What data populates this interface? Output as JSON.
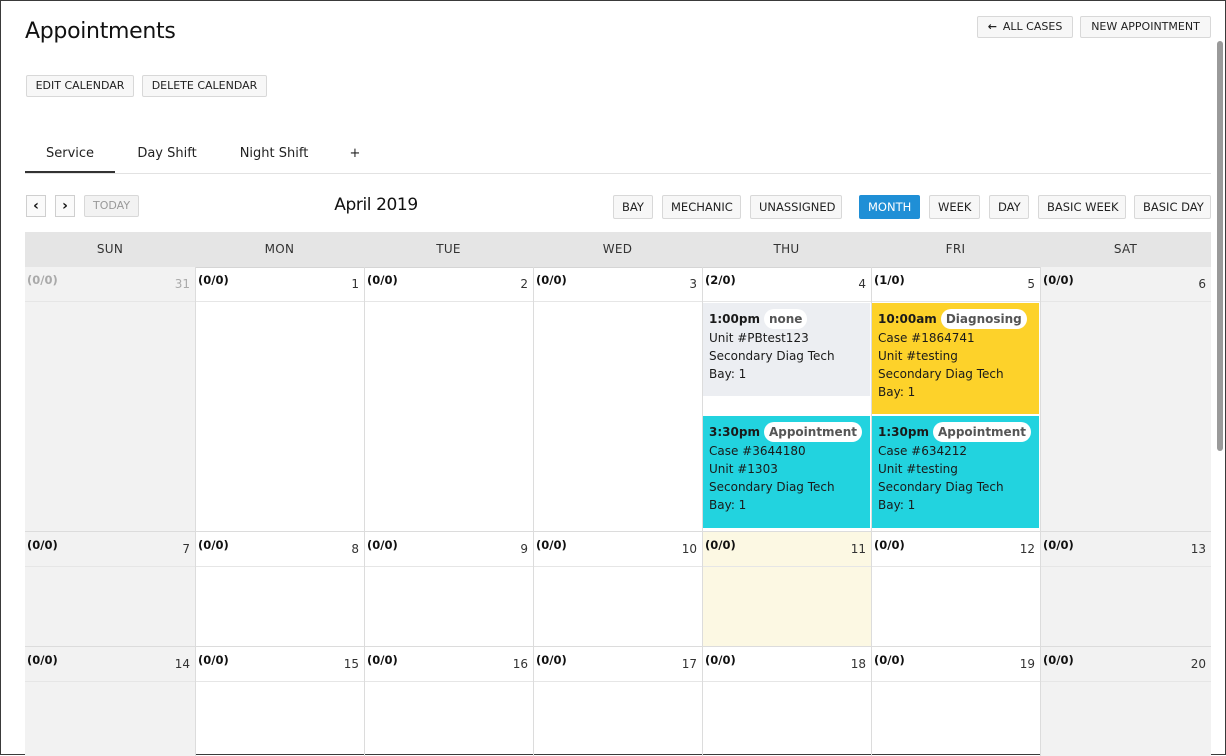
{
  "header": {
    "title": "Appointments",
    "all_cases": "ALL CASES",
    "new_appointment": "NEW APPOINTMENT",
    "edit_calendar": "EDIT CALENDAR",
    "delete_calendar": "DELETE CALENDAR"
  },
  "tabs": [
    {
      "label": "Service",
      "active": true
    },
    {
      "label": "Day Shift",
      "active": false
    },
    {
      "label": "Night Shift",
      "active": false
    },
    {
      "label": "+",
      "active": false
    }
  ],
  "toolbar": {
    "prev_icon": "chevron-left-icon",
    "next_icon": "chevron-right-icon",
    "today": "TODAY",
    "month_title": "April 2019",
    "group_buttons": [
      "BAY",
      "MECHANIC",
      "UNASSIGNED"
    ],
    "view_buttons": [
      "MONTH",
      "WEEK",
      "DAY",
      "BASIC WEEK",
      "BASIC DAY"
    ],
    "active_view": "MONTH"
  },
  "calendar": {
    "weekdays": [
      "SUN",
      "MON",
      "TUE",
      "WED",
      "THU",
      "FRI",
      "SAT"
    ],
    "weeks": [
      [
        {
          "day": "31",
          "count": "(0/0)",
          "other_month": true
        },
        {
          "day": "1",
          "count": "(0/0)"
        },
        {
          "day": "2",
          "count": "(0/0)"
        },
        {
          "day": "3",
          "count": "(0/0)"
        },
        {
          "day": "4",
          "count": "(2/0)"
        },
        {
          "day": "5",
          "count": "(1/0)"
        },
        {
          "day": "6",
          "count": "(0/0)"
        }
      ],
      [
        {
          "day": "7",
          "count": "(0/0)"
        },
        {
          "day": "8",
          "count": "(0/0)"
        },
        {
          "day": "9",
          "count": "(0/0)"
        },
        {
          "day": "10",
          "count": "(0/0)"
        },
        {
          "day": "11",
          "count": "(0/0)",
          "today": true
        },
        {
          "day": "12",
          "count": "(0/0)"
        },
        {
          "day": "13",
          "count": "(0/0)"
        }
      ],
      [
        {
          "day": "14",
          "count": "(0/0)"
        },
        {
          "day": "15",
          "count": "(0/0)"
        },
        {
          "day": "16",
          "count": "(0/0)"
        },
        {
          "day": "17",
          "count": "(0/0)"
        },
        {
          "day": "18",
          "count": "(0/0)"
        },
        {
          "day": "19",
          "count": "(0/0)"
        },
        {
          "day": "20",
          "count": "(0/0)"
        }
      ]
    ],
    "events": [
      {
        "week": 0,
        "weekday": 4,
        "slot": 0,
        "color": "grey",
        "time": "1:00pm",
        "status": "none",
        "lines": [
          "Unit #PBtest123",
          "Secondary Diag Tech",
          "Bay: 1"
        ]
      },
      {
        "week": 0,
        "weekday": 5,
        "slot": 0,
        "color": "yellow",
        "time": "10:00am",
        "status": "Diagnosing",
        "lines": [
          "Case #1864741",
          "Unit #testing",
          "Secondary Diag Tech",
          "Bay: 1"
        ]
      },
      {
        "week": 0,
        "weekday": 4,
        "slot": 1,
        "color": "cyan",
        "time": "3:30pm",
        "status": "Appointment",
        "lines": [
          "Case #3644180",
          "Unit #1303",
          "Secondary Diag Tech",
          "Bay: 1"
        ]
      },
      {
        "week": 0,
        "weekday": 5,
        "slot": 1,
        "color": "cyan",
        "time": "1:30pm",
        "status": "Appointment",
        "lines": [
          "Case #634212",
          "Unit #testing",
          "Secondary Diag Tech",
          "Bay: 1"
        ]
      }
    ]
  },
  "colors": {
    "accent": "#1f8fd6",
    "event_grey": "#eceef2",
    "event_yellow": "#fdd22a",
    "event_cyan": "#22d3df",
    "today_bg": "#fcf8e3"
  }
}
